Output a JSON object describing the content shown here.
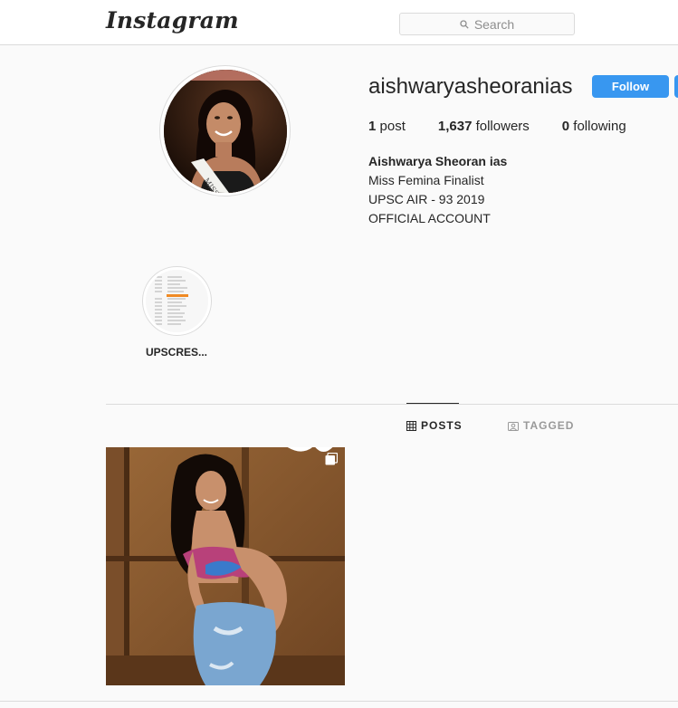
{
  "header": {
    "logo_text": "Instagram",
    "search_placeholder": "Search"
  },
  "profile": {
    "username": "aishwaryasheoranias",
    "follow_label": "Follow",
    "stats": {
      "posts_count": "1",
      "posts_label": " post",
      "followers_count": "1,637",
      "followers_label": " followers",
      "following_count": "0",
      "following_label": " following"
    },
    "bio": {
      "full_name": "Aishwarya Sheoran ias",
      "line1": "Miss Femina Finalist",
      "line2": "UPSC AIR - 93 2019",
      "line3": "OFFICIAL ACCOUNT"
    },
    "avatar_sash_text": "MISS B"
  },
  "highlights": [
    {
      "label": "UPSCRES..."
    }
  ],
  "tabs": [
    {
      "label": "POSTS",
      "icon": "grid-icon",
      "active": true
    },
    {
      "label": "TAGGED",
      "icon": "tagged-icon",
      "active": false
    }
  ],
  "colors": {
    "follow_button": "#3897f0",
    "background": "#fafafa",
    "border": "#dbdbdb"
  }
}
